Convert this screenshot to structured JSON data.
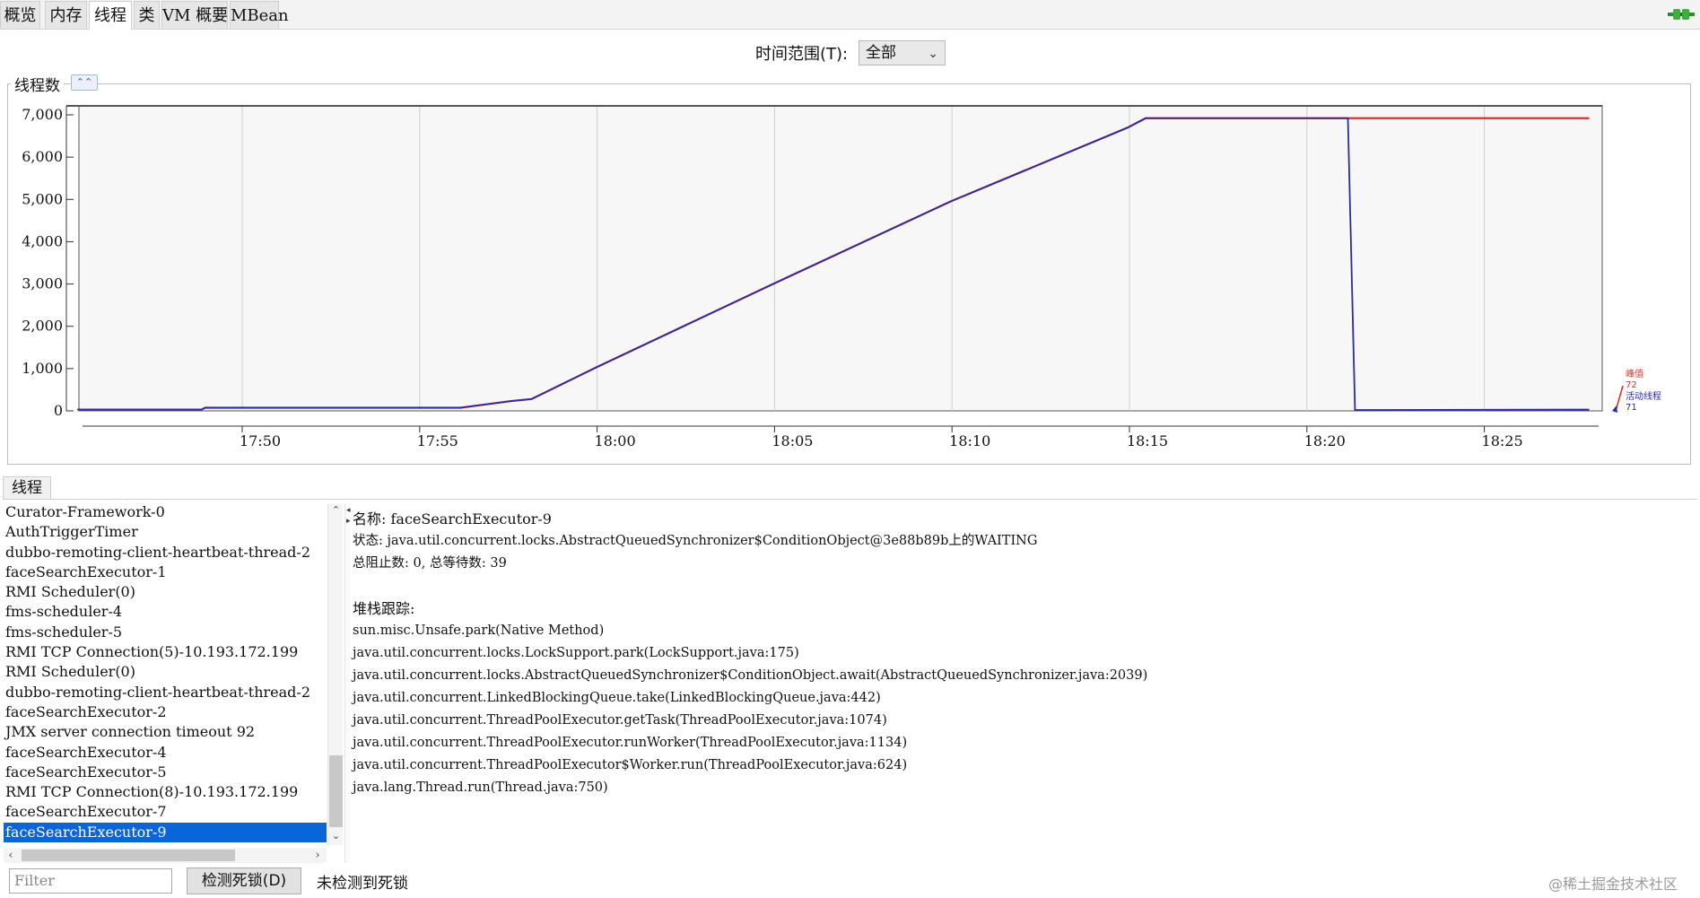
{
  "tabs": [
    {
      "label": "概览",
      "active": false
    },
    {
      "label": "内存",
      "active": false
    },
    {
      "label": "线程",
      "active": true
    },
    {
      "label": "类",
      "active": false
    },
    {
      "label": "VM 概要",
      "active": false
    },
    {
      "label": "MBean",
      "active": false
    }
  ],
  "connection_icon": "plug-connected-icon",
  "time_range": {
    "label": "时间范围(T):",
    "selected": "全部"
  },
  "chart_panel": {
    "title": "线程数",
    "collapse_icon": "chevron-double-up-icon"
  },
  "chart_data": {
    "type": "line",
    "x_ticks": [
      "17:50",
      "17:55",
      "18:00",
      "18:05",
      "18:10",
      "18:15",
      "18:20",
      "18:25"
    ],
    "y_ticks": [
      "7,000",
      "6,000",
      "5,000",
      "4,000",
      "3,000",
      "2,000",
      "1,000",
      "0"
    ],
    "ylim": [
      0,
      7000
    ],
    "xlim_minutes": [
      -4.6,
      38.2
    ],
    "grid": true,
    "legend_position": "right",
    "series": [
      {
        "name": "峰值",
        "color": "#d9342b",
        "legend_value": "72",
        "points": [
          [
            -4.6,
            30
          ],
          [
            -1.1,
            30
          ],
          [
            -1.0,
            75
          ],
          [
            6.2,
            75
          ],
          [
            7.6,
            230
          ],
          [
            8.2,
            280
          ],
          [
            10.0,
            1020
          ],
          [
            15.0,
            3000
          ],
          [
            20.0,
            4950
          ],
          [
            25.0,
            6700
          ],
          [
            25.5,
            6920
          ],
          [
            31.2,
            6920
          ],
          [
            31.2,
            6920
          ],
          [
            38.0,
            6920
          ]
        ]
      },
      {
        "name": "活动线程",
        "color": "#2b2aa0",
        "legend_value": "71",
        "points": [
          [
            -4.6,
            30
          ],
          [
            -1.1,
            30
          ],
          [
            -1.0,
            75
          ],
          [
            6.2,
            75
          ],
          [
            7.6,
            230
          ],
          [
            8.2,
            280
          ],
          [
            10.0,
            1020
          ],
          [
            15.0,
            3000
          ],
          [
            20.0,
            4950
          ],
          [
            25.0,
            6700
          ],
          [
            25.5,
            6920
          ],
          [
            31.2,
            6920
          ],
          [
            31.4,
            20
          ],
          [
            38.0,
            30
          ]
        ]
      }
    ]
  },
  "threads_section": {
    "tab_label": "线程",
    "list": [
      "Curator-Framework-0",
      "AuthTriggerTimer",
      "dubbo-remoting-client-heartbeat-thread-2",
      "faceSearchExecutor-1",
      "RMI Scheduler(0)",
      "fms-scheduler-4",
      "fms-scheduler-5",
      "RMI TCP Connection(5)-10.193.172.199",
      "RMI Scheduler(0)",
      "dubbo-remoting-client-heartbeat-thread-2",
      "faceSearchExecutor-2",
      "JMX server connection timeout 92",
      "faceSearchExecutor-4",
      "faceSearchExecutor-5",
      "RMI TCP Connection(8)-10.193.172.199",
      "faceSearchExecutor-7",
      "faceSearchExecutor-9"
    ],
    "selected_index": 16,
    "details": {
      "name_line": "名称: faceSearchExecutor-9",
      "state_line": "状态: java.util.concurrent.locks.AbstractQueuedSynchronizer$ConditionObject@3e88b89b上的WAITING",
      "counts_line": "总阻止数: 0, 总等待数: 39",
      "stack_title": "堆栈跟踪:",
      "stack": [
        "sun.misc.Unsafe.park(Native Method)",
        "java.util.concurrent.locks.LockSupport.park(LockSupport.java:175)",
        "java.util.concurrent.locks.AbstractQueuedSynchronizer$ConditionObject.await(AbstractQueuedSynchronizer.java:2039)",
        "java.util.concurrent.LinkedBlockingQueue.take(LinkedBlockingQueue.java:442)",
        "java.util.concurrent.ThreadPoolExecutor.getTask(ThreadPoolExecutor.java:1074)",
        "java.util.concurrent.ThreadPoolExecutor.runWorker(ThreadPoolExecutor.java:1134)",
        "java.util.concurrent.ThreadPoolExecutor$Worker.run(ThreadPoolExecutor.java:624)",
        "java.lang.Thread.run(Thread.java:750)"
      ]
    }
  },
  "bottom_bar": {
    "filter_placeholder": "Filter",
    "detect_button": "检测死锁(D)",
    "status": "未检测到死锁"
  },
  "watermark": "@稀土掘金技术社区"
}
